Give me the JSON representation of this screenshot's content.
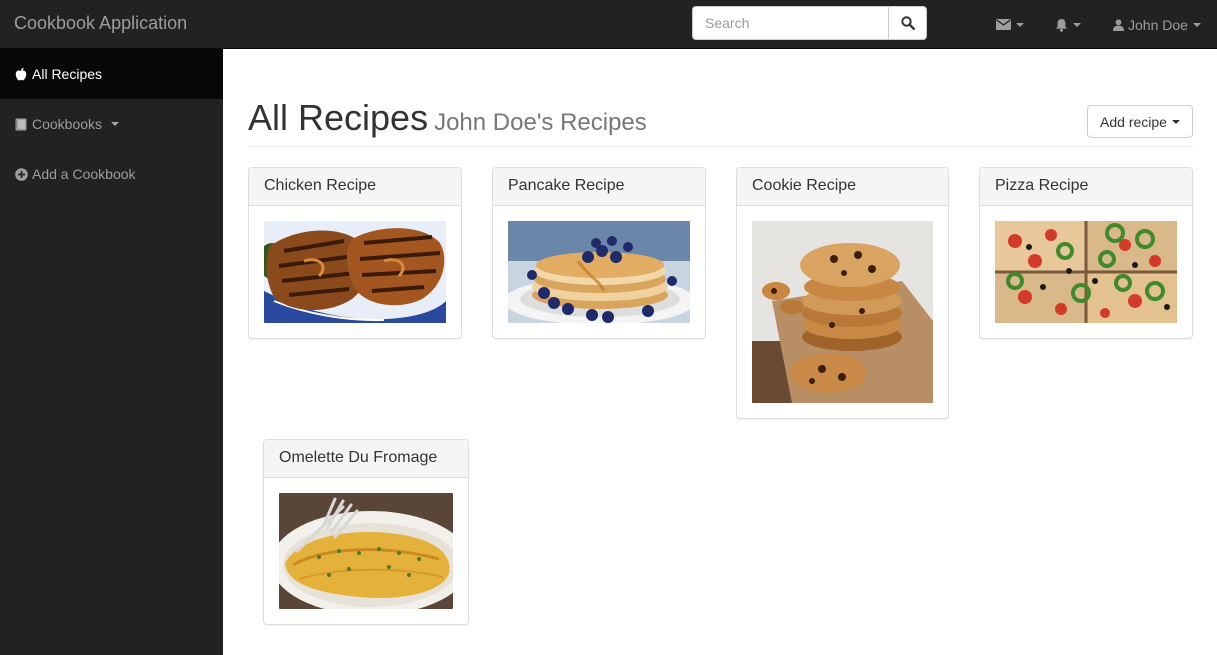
{
  "navbar": {
    "brand": "Cookbook Application",
    "search": {
      "placeholder": "Search",
      "value": ""
    },
    "messages_icon": "envelope-icon",
    "notifications_icon": "bell-icon",
    "user": {
      "icon": "user-icon",
      "name": "John Doe"
    }
  },
  "sidebar": {
    "items": [
      {
        "label": "All Recipes",
        "icon": "apple-icon",
        "active": true
      },
      {
        "label": "Cookbooks",
        "icon": "book-icon",
        "active": false,
        "dropdown": true
      },
      {
        "label": "Add a Cookbook",
        "icon": "plus-circle-icon",
        "active": false
      }
    ]
  },
  "main": {
    "title": "All Recipes",
    "subtitle": "John Doe's Recipes",
    "add_button": "Add recipe",
    "recipes": [
      {
        "title": "Chicken Recipe",
        "image": "grilled-chicken-photo"
      },
      {
        "title": "Pancake Recipe",
        "image": "blueberry-pancakes-photo"
      },
      {
        "title": "Cookie Recipe",
        "image": "chocolate-chip-cookies-photo"
      },
      {
        "title": "Pizza Recipe",
        "image": "vegetable-pizza-photo"
      },
      {
        "title": "Omelette Du Fromage",
        "image": "cheese-omelette-photo"
      }
    ]
  },
  "colors": {
    "navbar_bg": "#222222",
    "sidebar_active_bg": "#080808",
    "panel_heading_bg": "#f5f5f5"
  }
}
